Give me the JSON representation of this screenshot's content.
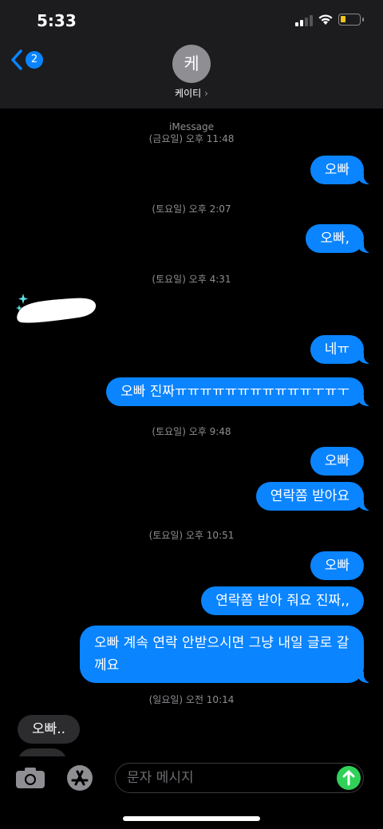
{
  "status": {
    "time": "5:33"
  },
  "header": {
    "back_badge": "2",
    "avatar_initial": "케",
    "contact_name": "케이티",
    "contact_chevron": "›"
  },
  "thread": {
    "service_label": "iMessage",
    "stamps": [
      "(금요일) 오후 11:48",
      "(토요일) 오후 2:07",
      "(토요일) 오후 4:31",
      "(토요일) 오후 9:48",
      "(토요일) 오후 10:51",
      "(일요일) 오전 10:14"
    ],
    "messages": [
      "오빠",
      "오빠,",
      "네ㅠ",
      "오빠 진짜ㅠㅠㅠㅠㅠㅠㅠㅠㅠㅠㅠㅜㅠㅜ",
      "오빠",
      "연락쫌 받아요",
      "오빠",
      "연락쫌 받아 줘요 진짜,,",
      "오빠 계속 연락 안받으시면 그냥 내일 글로 갈께요",
      "오빠.."
    ]
  },
  "input": {
    "placeholder": "문자 메시지"
  },
  "icons": {
    "back": "chevron-left-icon",
    "camera": "camera-icon",
    "appstore": "app-store-icon",
    "send": "send-arrow-icon"
  },
  "colors": {
    "outgoing": "#0a84ff",
    "incoming": "#2c2c2e",
    "send": "#30d158"
  }
}
